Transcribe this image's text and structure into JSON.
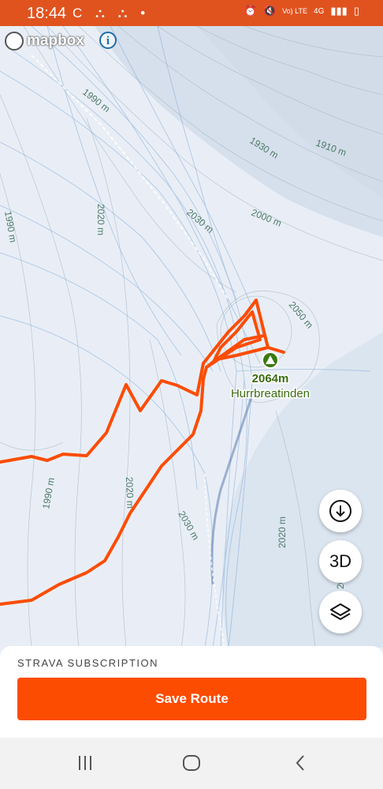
{
  "status_bar": {
    "time": "18:44",
    "left_icons": "C ⛬ ⛬ •",
    "right_icons": [
      "alarm-icon",
      "mute-icon",
      "volte-icon",
      "4g-icon",
      "signal-icon",
      "battery-icon"
    ],
    "volte_text": "Vo) LTE",
    "net_text": "4G"
  },
  "map": {
    "logo_text": "mapbox",
    "peak": {
      "elevation": "2064m",
      "name": "Hurrbreatinden"
    },
    "contour_labels": [
      "1990 m",
      "1930 m",
      "1910 m",
      "2020 m",
      "1990 m",
      "2030 m",
      "2000 m",
      "2050 m",
      "1990 m",
      "2020 m",
      "2030 m",
      "2020 m",
      "20"
    ]
  },
  "controls": {
    "three_d_label": "3D"
  },
  "bottom_sheet": {
    "subscription_label": "STRAVA SUBSCRIPTION",
    "save_label": "Save Route"
  },
  "colors": {
    "status_bar": "#e0531f",
    "route": "#fc4c02",
    "button": "#fc4c02",
    "peak_label": "#3a6b12"
  }
}
